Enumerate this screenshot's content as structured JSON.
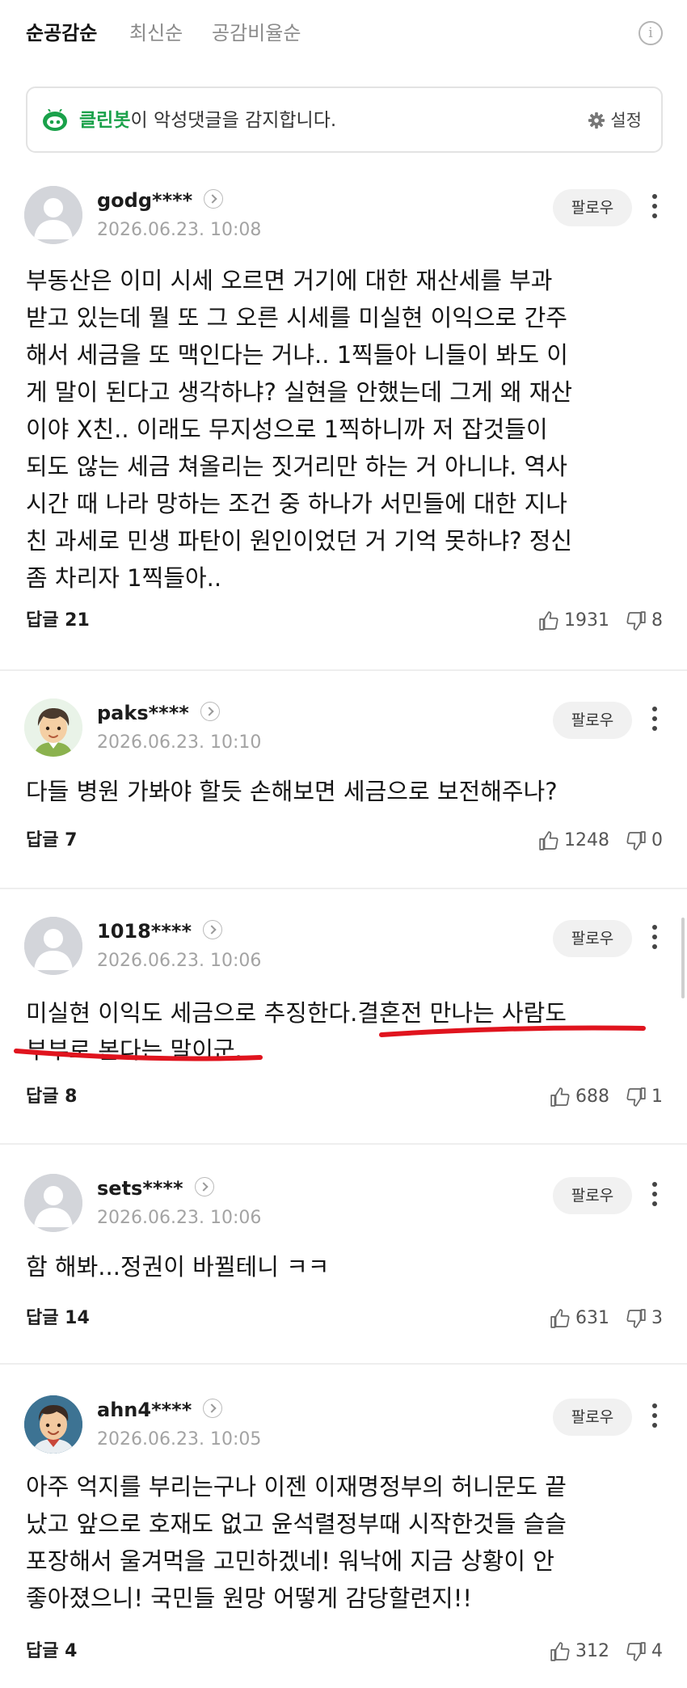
{
  "tabs": [
    {
      "label": "순공감순",
      "active": true
    },
    {
      "label": "최신순",
      "active": false
    },
    {
      "label": "공감비율순",
      "active": false
    }
  ],
  "info_icon": "info-circle-icon",
  "banner": {
    "brand": "클린봇",
    "text": "이 악성댓글을 감지합니다.",
    "settings_label": "설정",
    "brand_color": "#1aa14a"
  },
  "follow_label": "팔로우",
  "comments": [
    {
      "nick": "godg****",
      "date": "2026.06.23. 10:08",
      "lines": [
        "부동산은 이미 시세 오르면 거기에 대한 재산세를 부과",
        "받고 있는데 뭘 또 그 오른 시세를 미실현 이익으로 간주",
        "해서 세금을 또 맥인다는 거냐.. 1찍들아 니들이 봐도 이",
        "게 말이 된다고 생각하냐? 실현을 안했는데 그게 왜 재산",
        "이야 X친.. 이래도 무지성으로 1찍하니까 저 잡것들이",
        "되도 않는 세금 쳐올리는 짓거리만 하는 거 아니냐. 역사",
        "시간 때 나라 망하는 조건 중 하나가 서민들에 대한 지나",
        "친 과세로 민생 파탄이 원인이었던 거 기억 못하냐? 정신",
        "좀 차리자 1찍들아.."
      ],
      "reply": "답글 21",
      "likes": "1931",
      "dislikes": "8",
      "avatar": "default-avatar"
    },
    {
      "nick": "paks****",
      "date": "2026.06.23. 10:10",
      "lines": [
        "다들 병원 가봐야 할듯 손해보면 세금으로 보전해주나?"
      ],
      "reply": "답글 7",
      "likes": "1248",
      "dislikes": "0",
      "avatar": "cartoon-boy-avatar"
    },
    {
      "nick": "1018****",
      "date": "2026.06.23. 10:06",
      "lines": [
        "미실현 이익도 세금으로 추징한다.결혼전 만나는 사람도",
        "부부로 본다는 말이군."
      ],
      "reply": "답글 8",
      "likes": "688",
      "dislikes": "1",
      "avatar": "default-avatar",
      "annotation_color": "#e0141e"
    },
    {
      "nick": "sets****",
      "date": "2026.06.23. 10:06",
      "lines": [
        "함 해봐...정권이 바뀔테니 ㅋㅋ"
      ],
      "reply": "답글 14",
      "likes": "631",
      "dislikes": "3",
      "avatar": "default-avatar"
    },
    {
      "nick": "ahn4****",
      "date": "2026.06.23. 10:05",
      "lines": [
        "아주 억지를 부리는구나 이젠 이재명정부의 허니문도 끝",
        "났고 앞으로 호재도 없고 윤석렬정부때 시작한것들 슬슬",
        "포장해서 울겨먹을 고민하겠네! 워낙에 지금 상황이 안",
        "좋아졌으니! 국민들 원망 어떻게 감당할련지!!"
      ],
      "reply": "답글 4",
      "likes": "312",
      "dislikes": "4",
      "avatar": "cartoon-man-avatar"
    }
  ]
}
